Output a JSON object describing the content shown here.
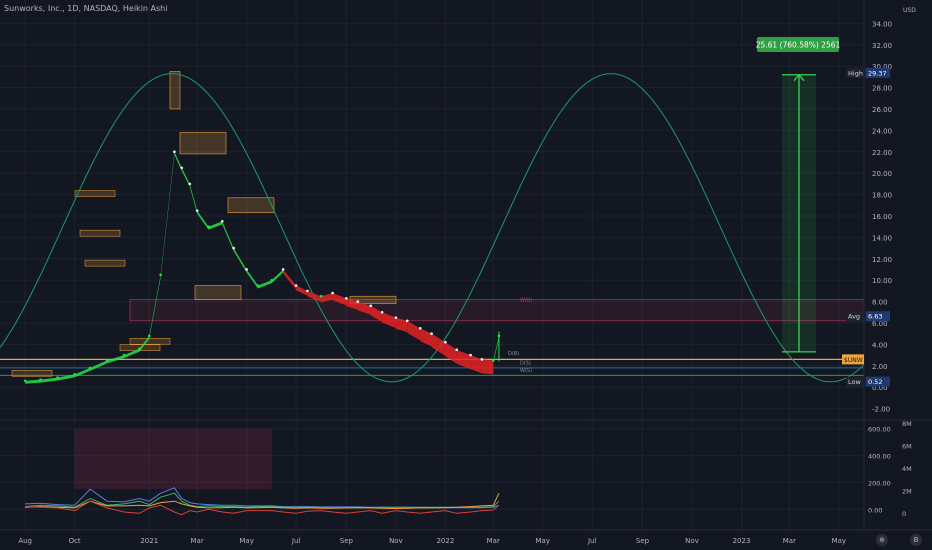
{
  "header": {
    "title": "Sunworks, Inc., 1D, NASDAQ, Heikin Ashi",
    "settings_icon": "gear-icon",
    "currency": "USD"
  },
  "colors": {
    "bg": "#131722",
    "bull": "#26e04a",
    "bear": "#e52222",
    "sine": "#1b9a6a",
    "measure": "#39d353",
    "price_line": "#f0a33a",
    "avg_line": "#c43a5a"
  },
  "chart_data": {
    "type": "line",
    "title": "Sunworks, Inc., 1D, NASDAQ, Heikin Ashi",
    "x": [
      "2020-08-01",
      "2020-08-20",
      "2020-09-10",
      "2020-10-01",
      "2020-10-20",
      "2020-11-10",
      "2020-12-01",
      "2020-12-20",
      "2021-01-01",
      "2021-01-15",
      "2021-02-01",
      "2021-02-10",
      "2021-02-20",
      "2021-03-01",
      "2021-03-15",
      "2021-04-01",
      "2021-04-15",
      "2021-05-01",
      "2021-05-15",
      "2021-06-01",
      "2021-06-15",
      "2021-07-01",
      "2021-07-15",
      "2021-08-01",
      "2021-08-15",
      "2021-09-01",
      "2021-09-15",
      "2021-10-01",
      "2021-10-15",
      "2021-11-01",
      "2021-11-15",
      "2021-12-01",
      "2021-12-15",
      "2022-01-01",
      "2022-01-15",
      "2022-02-01",
      "2022-02-15",
      "2022-03-01",
      "2022-03-08"
    ],
    "series": [
      {
        "values": [
          0.6,
          0.7,
          0.9,
          1.2,
          1.8,
          2.5,
          3.0,
          3.6,
          4.8,
          10.5,
          22.0,
          20.5,
          19.0,
          16.5,
          15.0,
          15.5,
          13.0,
          11.0,
          9.5,
          10.0,
          11.0,
          9.5,
          9.0,
          8.5,
          8.8,
          8.3,
          8.0,
          7.6,
          7.0,
          6.5,
          6.2,
          5.5,
          5.0,
          4.2,
          3.5,
          3.0,
          2.6,
          2.5,
          4.8
        ]
      }
    ],
    "yticks": [
      "34.00",
      "32.00",
      "30.00",
      "28.00",
      "26.00",
      "24.00",
      "22.00",
      "20.00",
      "18.00",
      "16.00",
      "14.00",
      "12.00",
      "10.00",
      "8.00",
      "6.00",
      "4.00",
      "2.00",
      "0.00",
      "-2.00"
    ],
    "xticks": [
      "Aug",
      "Oct",
      "2021",
      "Mar",
      "May",
      "Jul",
      "Sep",
      "Nov",
      "2022",
      "Mar",
      "May",
      "Jul",
      "Sep",
      "Nov",
      "2023",
      "Mar",
      "May"
    ],
    "ylim": [
      -2.6,
      34.5
    ],
    "grid": true,
    "annotations": {
      "measure": "25.61 (760.58%) 2561",
      "high_label": "High",
      "high_value": "29.37",
      "avg_label": "Avg",
      "avg_value": "6.63",
      "low_label": "Low",
      "low_value": "0.52",
      "ticker": "$UNW",
      "level_labels": [
        "D(B)",
        "D(S)",
        "W(S)",
        "W(B)"
      ]
    },
    "indicator": {
      "yticks": [
        "600.00",
        "400.00",
        "200.00",
        "0.00"
      ],
      "right_ticks": [
        "8M",
        "6M",
        "4M",
        "2M",
        "0"
      ],
      "osc_green": [
        20,
        30,
        25,
        15,
        80,
        30,
        40,
        60,
        35,
        90,
        120,
        60,
        30,
        20,
        25,
        20,
        20,
        15,
        20,
        20,
        15,
        15,
        15,
        15,
        10,
        12,
        15,
        12,
        15,
        15,
        15,
        15,
        15,
        15,
        15,
        15,
        15,
        20,
        60
      ],
      "osc_blue": [
        40,
        45,
        35,
        30,
        150,
        60,
        55,
        80,
        60,
        120,
        160,
        80,
        50,
        40,
        35,
        30,
        30,
        25,
        25,
        25,
        20,
        20,
        20,
        18,
        18,
        18,
        18,
        15,
        15,
        15,
        15,
        12,
        12,
        12,
        12,
        12,
        12,
        15,
        30
      ],
      "osc_orange": [
        15,
        20,
        15,
        10,
        60,
        25,
        25,
        30,
        25,
        50,
        60,
        40,
        25,
        15,
        10,
        12,
        15,
        10,
        12,
        15,
        10,
        8,
        10,
        8,
        8,
        10,
        12,
        10,
        8,
        6,
        8,
        10,
        10,
        12,
        15,
        20,
        25,
        30,
        120
      ],
      "osc_red": [
        20,
        15,
        10,
        -10,
        60,
        10,
        -20,
        -30,
        10,
        30,
        -20,
        -40,
        -10,
        -20,
        0,
        -20,
        -30,
        -10,
        -10,
        -10,
        -20,
        -30,
        -15,
        -10,
        -20,
        -30,
        -20,
        -10,
        -30,
        -10,
        -20,
        -30,
        -20,
        -10,
        -30,
        -20,
        -10,
        -5,
        30
      ]
    }
  },
  "nav": {
    "target_icon": "crosshair-icon",
    "scale_icon": "b-icon"
  }
}
